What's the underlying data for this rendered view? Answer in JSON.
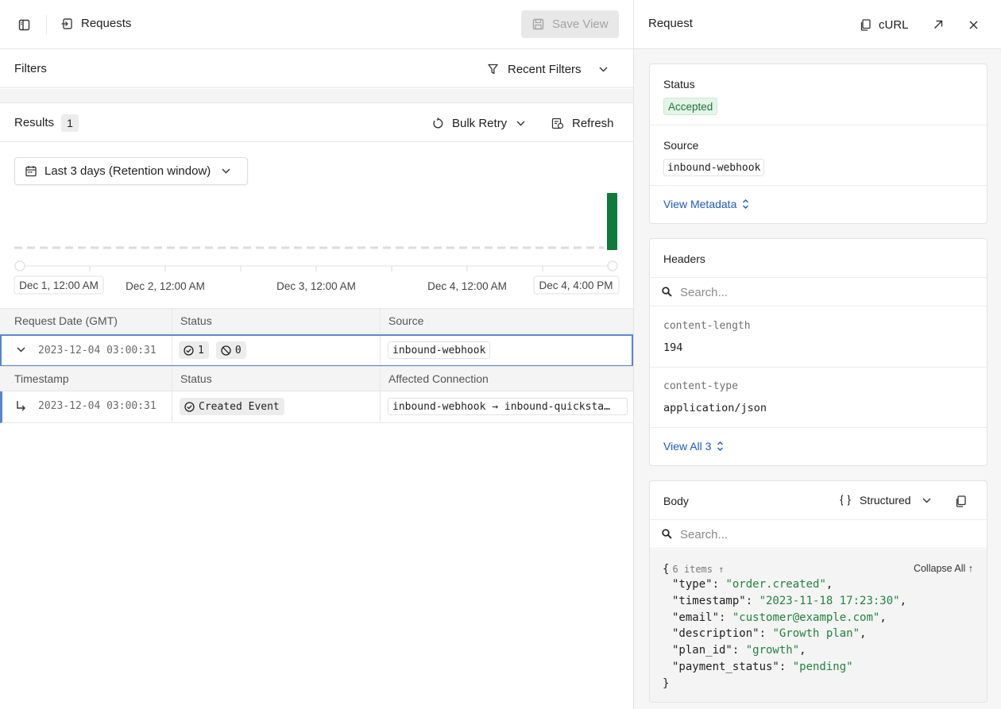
{
  "header": {
    "title": "Requests",
    "save_view_label": "Save View"
  },
  "filters": {
    "label": "Filters",
    "recent_filters_label": "Recent Filters"
  },
  "results": {
    "label": "Results",
    "count": "1",
    "bulk_retry_label": "Bulk Retry",
    "refresh_label": "Refresh"
  },
  "date_range": {
    "label": "Last 3 days (Retention window)"
  },
  "histogram": {
    "start_label": "Dec 1, 12:00 AM",
    "ticks": [
      "Dec 2, 12:00 AM",
      "Dec 3, 12:00 AM",
      "Dec 4, 12:00 AM"
    ],
    "end_label": "Dec 4, 4:00 PM",
    "bar_color": "#0f7a3a"
  },
  "table": {
    "columns": [
      "Request Date (GMT)",
      "Status",
      "Source"
    ],
    "row": {
      "date": "2023-12-04 03:00:31",
      "accepted_count": "1",
      "rejected_count": "0",
      "source": "inbound-webhook"
    },
    "sub_columns": [
      "Timestamp",
      "Status",
      "Affected Connection"
    ],
    "sub_row": {
      "timestamp": "2023-12-04 03:00:31",
      "status": "Created Event",
      "connection": "inbound-webhook → inbound-quicksta…"
    }
  },
  "panel": {
    "title": "Request",
    "curl_label": "cURL",
    "status_label": "Status",
    "status_value": "Accepted",
    "source_label": "Source",
    "source_value": "inbound-webhook",
    "view_metadata_label": "View Metadata",
    "headers_label": "Headers",
    "headers_search_placeholder": "Search...",
    "headers": [
      {
        "key": "content-length",
        "value": "194"
      },
      {
        "key": "content-type",
        "value": "application/json"
      }
    ],
    "view_all_label": "View All 3",
    "body_label": "Body",
    "body_mode": "Structured",
    "body_search_placeholder": "Search...",
    "json_items_label": "6 items ↑",
    "collapse_all_label": "Collapse All ↑",
    "json": [
      {
        "key": "\"type\"",
        "value": "\"order.created\""
      },
      {
        "key": "\"timestamp\"",
        "value": "\"2023-11-18 17:23:30\""
      },
      {
        "key": "\"email\"",
        "value": "\"customer@example.com\""
      },
      {
        "key": "\"description\"",
        "value": "\"Growth plan\""
      },
      {
        "key": "\"plan_id\"",
        "value": "\"growth\""
      },
      {
        "key": "\"payment_status\"",
        "value": "\"pending\""
      }
    ]
  },
  "colors": {
    "accent_link": "#1d59c7",
    "success": "#22833f",
    "selected_row_border": "#5b84d0"
  }
}
